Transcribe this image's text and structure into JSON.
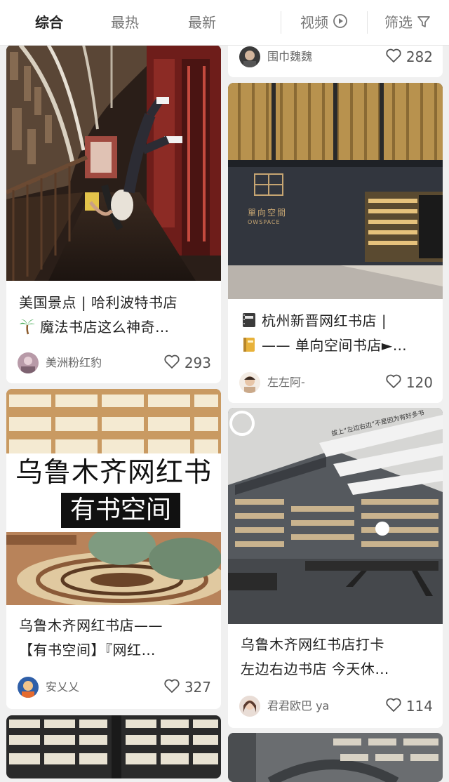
{
  "tabs": {
    "comprehensive": "综合",
    "hottest": "最热",
    "newest": "最新",
    "video": "视频",
    "filter": "筛选"
  },
  "colors": {
    "accent": "#222222",
    "muted": "#777777",
    "background": "#f0f0f0"
  },
  "feed": {
    "left": [
      {
        "title_line1": "美国景点 | 哈利波特书店",
        "title_line2": "魔法书店这么神奇…",
        "title_emoji": "palm-tree",
        "author": "美洲粉红豹",
        "likes": "293"
      },
      {
        "image_caption_big": "乌鲁木齐网红书店",
        "image_caption_sub": "有书空间",
        "title_line1": "乌鲁木齐网红书店——",
        "title_line2": "【有书空间】『网红…",
        "author": "安乂乂",
        "likes": "327"
      }
    ],
    "right": [
      {
        "author": "围巾魏魏",
        "likes": "282"
      },
      {
        "image_sign_main": "單向空間",
        "image_sign_sub": "OWSPACE",
        "title_line1": "杭州新晋网红书店 |",
        "title_line2": "——  单向空间书店►…",
        "title_emoji1": "notebook",
        "title_emoji2": "ledger",
        "author": "左左阿-",
        "likes": "120"
      },
      {
        "image_banner_text": "拔上“左边右边”不是因为有好多书",
        "title_line1": "乌鲁木齐网红书店打卡",
        "title_line2": "左边右边书店 今天休…",
        "author": "君君欧巴 ya",
        "likes": "114"
      }
    ]
  }
}
